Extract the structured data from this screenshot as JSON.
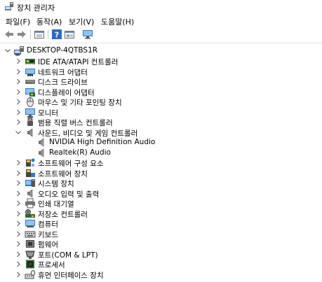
{
  "window": {
    "title": "장치 관리자"
  },
  "menu": [
    {
      "label": "파일(F)"
    },
    {
      "label": "동작(A)"
    },
    {
      "label": "보기(V)"
    },
    {
      "label": "도움말(H)"
    }
  ],
  "toolbar": {
    "buttons": [
      "back-arrow-icon",
      "forward-arrow-icon",
      "properties-icon",
      "help-icon",
      "details-icon",
      "monitor-scan-icon"
    ]
  },
  "tree": {
    "root": "DESKTOP-4QTBS1R",
    "categories": [
      {
        "label": "IDE ATA/ATAPI 컨트롤러",
        "icon": "ide-controller-icon",
        "expanded": false
      },
      {
        "label": "네트워크 어댑터",
        "icon": "network-adapter-icon",
        "expanded": false
      },
      {
        "label": "디스크 드라이브",
        "icon": "disk-drive-icon",
        "expanded": false
      },
      {
        "label": "디스플레이 어댑터",
        "icon": "display-adapter-icon",
        "expanded": false
      },
      {
        "label": "마우스 및 기타 포인팅 장치",
        "icon": "mouse-icon",
        "expanded": false
      },
      {
        "label": "모니터",
        "icon": "monitor-icon",
        "expanded": false
      },
      {
        "label": "범용 직렬 버스 컨트롤러",
        "icon": "usb-controller-icon",
        "expanded": false
      },
      {
        "label": "사운드, 비디오 및 게임 컨트롤러",
        "icon": "speaker-icon",
        "expanded": true,
        "children": [
          {
            "label": "NVIDIA High Definition Audio",
            "icon": "speaker-icon"
          },
          {
            "label": "Realtek(R) Audio",
            "icon": "speaker-icon"
          }
        ]
      },
      {
        "label": "소프트웨어 구성 요소",
        "icon": "software-component-icon",
        "expanded": false
      },
      {
        "label": "소프트웨어 장치",
        "icon": "software-device-icon",
        "expanded": false
      },
      {
        "label": "시스템 장치",
        "icon": "system-device-icon",
        "expanded": false
      },
      {
        "label": "오디오 입력 및 출력",
        "icon": "audio-io-icon",
        "expanded": false
      },
      {
        "label": "인쇄 대기열",
        "icon": "print-queue-icon",
        "expanded": false
      },
      {
        "label": "저장소 컨트롤러",
        "icon": "storage-controller-icon",
        "expanded": false
      },
      {
        "label": "컴퓨터",
        "icon": "computer-icon",
        "expanded": false
      },
      {
        "label": "키보드",
        "icon": "keyboard-icon",
        "expanded": false
      },
      {
        "label": "펌웨어",
        "icon": "firmware-icon",
        "expanded": false
      },
      {
        "label": "포트(COM & LPT)",
        "icon": "port-icon",
        "expanded": false
      },
      {
        "label": "프로세서",
        "icon": "processor-icon",
        "expanded": false
      },
      {
        "label": "휴먼 인터페이스 장치",
        "icon": "hid-icon",
        "expanded": false
      }
    ]
  },
  "colors": {
    "accent": "#1e70c8",
    "chevron": "#606060"
  }
}
